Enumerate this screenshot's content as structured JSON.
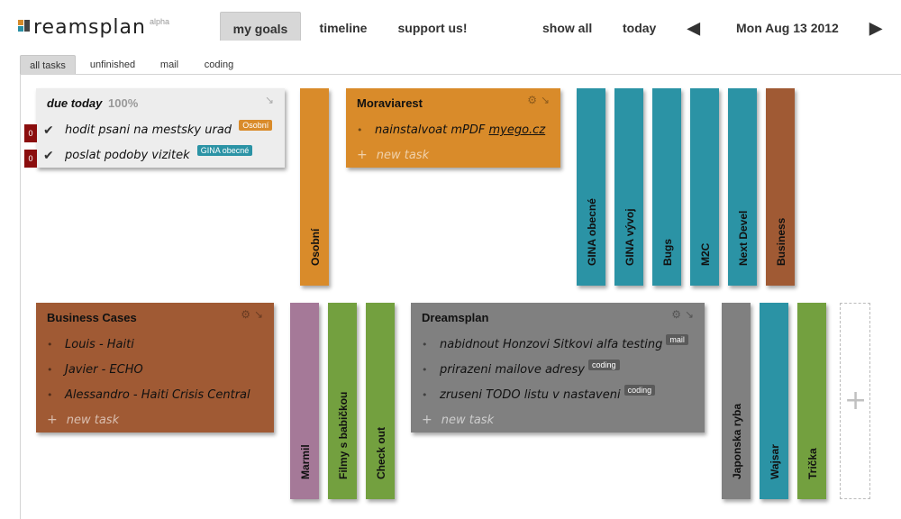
{
  "app": {
    "logo_text": "reamsplan",
    "logo_sup": "alpha"
  },
  "nav": {
    "tabs": [
      {
        "label": "my goals",
        "active": true
      },
      {
        "label": "timeline",
        "active": false
      },
      {
        "label": "support us!",
        "active": false
      }
    ],
    "show_all": "show all",
    "today": "today",
    "prev_arrow": "🡐",
    "date": "Mon Aug 13 2012",
    "next_arrow": "🡒"
  },
  "filters": [
    {
      "label": "all tasks",
      "active": true
    },
    {
      "label": "unfinished",
      "active": false
    },
    {
      "label": "mail",
      "active": false
    },
    {
      "label": "coding",
      "active": false
    }
  ],
  "colors": {
    "orange": "#d98b2a",
    "teal": "#2b93a5",
    "brown": "#a05a34",
    "gray": "#808080",
    "mauve": "#a57998",
    "green": "#73a03f",
    "due_bg": "#ededed",
    "count_red": "#8b0e0e"
  },
  "due_today": {
    "title": "due today",
    "percent": "100%",
    "tasks": [
      {
        "count": "0",
        "text": "hodit psani na mestsky urad",
        "tag": "Osobní",
        "tag_color": "#d98b2a"
      },
      {
        "count": "0",
        "text": "poslat podoby vizitek",
        "tag": "GINA obecné",
        "tag_color": "#2b93a5"
      }
    ]
  },
  "cards": {
    "moraviarest": {
      "title": "Moraviarest",
      "tasks": [
        {
          "text": "nainstalvoat mPDF ",
          "link": "myego.cz"
        }
      ],
      "new_task": "new task"
    },
    "business_cases": {
      "title": "Business Cases",
      "tasks": [
        "Louis - Haiti",
        "Javier - ECHO",
        "Alessandro - Haiti Crisis Central"
      ],
      "new_task": "new task"
    },
    "dreamsplan": {
      "title": "Dreamsplan",
      "tasks": [
        {
          "text": "nabidnout Honzovi Sitkovi alfa testing",
          "tag": "mail"
        },
        {
          "text": "prirazeni mailove adresy",
          "tag": "coding"
        },
        {
          "text": "zruseni TODO listu v nastaveni",
          "tag": "coding"
        }
      ],
      "new_task": "new task"
    }
  },
  "columns_top": [
    "Osobní",
    "GINA obecné",
    "GINA vývoj",
    "Bugs",
    "M2C",
    "Next Devel",
    "Business"
  ],
  "columns_bottom": [
    "Marmil",
    "Filmy s babičkou",
    "Check out",
    "Japonska ryba",
    "Wajsar",
    "Trička"
  ],
  "add_column": "+"
}
